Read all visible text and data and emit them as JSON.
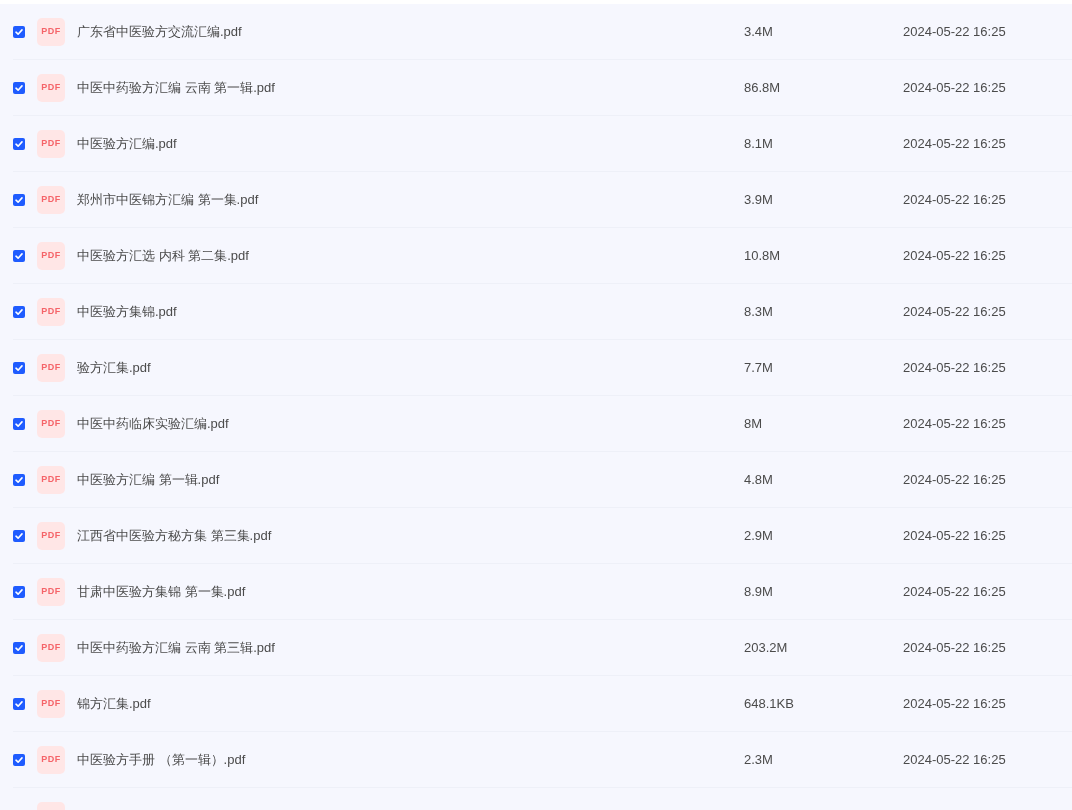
{
  "files": [
    {
      "kind": "file",
      "checked": true,
      "type_badge": "PDF",
      "name": "广东省中医验方交流汇编.pdf",
      "size": "3.4M",
      "date": "2024-05-22 16:25"
    },
    {
      "kind": "file",
      "checked": true,
      "type_badge": "PDF",
      "name": "中医中药验方汇编 云南 第一辑.pdf",
      "size": "86.8M",
      "date": "2024-05-22 16:25"
    },
    {
      "kind": "file",
      "checked": true,
      "type_badge": "PDF",
      "name": "中医验方汇编.pdf",
      "size": "8.1M",
      "date": "2024-05-22 16:25"
    },
    {
      "kind": "file",
      "checked": true,
      "type_badge": "PDF",
      "name": "郑州市中医锦方汇编 第一集.pdf",
      "size": "3.9M",
      "date": "2024-05-22 16:25"
    },
    {
      "kind": "file",
      "checked": true,
      "type_badge": "PDF",
      "name": "中医验方汇选 内科 第二集.pdf",
      "size": "10.8M",
      "date": "2024-05-22 16:25"
    },
    {
      "kind": "file",
      "checked": true,
      "type_badge": "PDF",
      "name": "中医验方集锦.pdf",
      "size": "8.3M",
      "date": "2024-05-22 16:25"
    },
    {
      "kind": "file",
      "checked": true,
      "type_badge": "PDF",
      "name": "验方汇集.pdf",
      "size": "7.7M",
      "date": "2024-05-22 16:25"
    },
    {
      "kind": "file",
      "checked": true,
      "type_badge": "PDF",
      "name": "中医中药临床实验汇编.pdf",
      "size": "8M",
      "date": "2024-05-22 16:25"
    },
    {
      "kind": "file",
      "checked": true,
      "type_badge": "PDF",
      "name": "中医验方汇编 第一辑.pdf",
      "size": "4.8M",
      "date": "2024-05-22 16:25"
    },
    {
      "kind": "file",
      "checked": true,
      "type_badge": "PDF",
      "name": "江西省中医验方秘方集 第三集.pdf",
      "size": "2.9M",
      "date": "2024-05-22 16:25"
    },
    {
      "kind": "file",
      "checked": true,
      "type_badge": "PDF",
      "name": "甘肃中医验方集锦 第一集.pdf",
      "size": "8.9M",
      "date": "2024-05-22 16:25"
    },
    {
      "kind": "file",
      "checked": true,
      "type_badge": "PDF",
      "name": "中医中药验方汇编 云南 第三辑.pdf",
      "size": "203.2M",
      "date": "2024-05-22 16:25"
    },
    {
      "kind": "file",
      "checked": true,
      "type_badge": "PDF",
      "name": "锦方汇集.pdf",
      "size": "648.1KB",
      "date": "2024-05-22 16:25"
    },
    {
      "kind": "file",
      "checked": true,
      "type_badge": "PDF",
      "name": "中医验方手册 （第一辑）.pdf",
      "size": "2.3M",
      "date": "2024-05-22 16:25"
    },
    {
      "kind": "cut_off"
    }
  ]
}
